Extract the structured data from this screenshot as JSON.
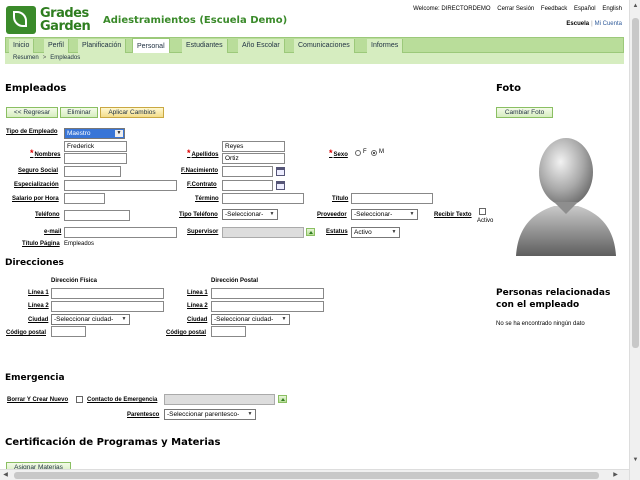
{
  "header": {
    "logo_line1": "Grades",
    "logo_line2": "Garden",
    "app_title": "Adiestramientos (Escuela Demo)",
    "welcome": "Welcome: DIRECTORDEMO",
    "cerrar_sesion": "Cerrar Sesión",
    "feedback": "Feedback",
    "espanol": "Español",
    "english": "English",
    "escuela": "Escuela",
    "mi_cuenta": "Mi Cuenta"
  },
  "nav": {
    "tabs": [
      "Inicio",
      "Perfil",
      "Planificación",
      "Personal",
      "Estudiantes",
      "Año Escolar",
      "Comunicaciones",
      "Informes"
    ],
    "active": "Personal"
  },
  "breadcrumb": [
    "Resumen",
    "Empleados"
  ],
  "empleados": {
    "title": "Empleados",
    "regresar": "<< Regresar",
    "eliminar": "Eliminar",
    "aplicar": "Aplicar Cambios"
  },
  "form": {
    "tipo_empleado_label": "Tipo de Empleado",
    "tipo_empleado_value": "Maestro",
    "nombres_label": "Nombres",
    "nombres_value": "Frederick",
    "apellidos_label": "Apellidos",
    "apellido1_value": "Reyes",
    "apellido2_value": "Ortiz",
    "sexo_label": "Sexo",
    "sexo_f": "F",
    "sexo_m": "M",
    "seguro_social_label": "Seguro Social",
    "f_nacimiento_label": "F.Nacimiento",
    "especializacion_label": "Especialización",
    "f_contrato_label": "F.Contrato",
    "salario_label": "Salario por Hora",
    "termino_label": "Término",
    "titulo_label": "Título",
    "telefono_label": "Teléfono",
    "tipo_telefono_label": "Tipo Teléfono",
    "tipo_telefono_value": "-Seleccionar-",
    "proveedor_label": "Proveedor",
    "proveedor_value": "-Seleccionar-",
    "recibir_texto_label": "Recibir Texto",
    "activo_label": "Activo",
    "email_label": "e-mail",
    "supervisor_label": "Supervisor",
    "estatus_label": "Estatus",
    "estatus_value": "Activo",
    "titulo_pagina_label": "Título Página",
    "titulo_pagina_value": "Empleados"
  },
  "foto": {
    "title": "Foto",
    "cambiar": "Cambiar Foto"
  },
  "direcciones": {
    "title": "Direcciones",
    "fisica": "Dirección Física",
    "postal": "Dirección Postal",
    "linea1": "Línea 1",
    "linea2": "Línea 2",
    "ciudad": "Ciudad",
    "ciudad_value": "-Seleccionar ciudad-",
    "codigo_postal": "Código postal"
  },
  "relacionadas": {
    "title_line1": "Personas relacionadas",
    "title_line2": "con el empleado",
    "empty": "No se ha encontrado ningún dato"
  },
  "emergencia": {
    "title": "Emergencia",
    "borrar_crear": "Borrar Y Crear Nuevo",
    "contacto": "Contacto de Emergencia",
    "parentesco": "Parentesco",
    "parentesco_value": "-Seleccionar parentesco-"
  },
  "certificacion": {
    "title": "Certificación de Programas y Materias",
    "asignar": "Asignar Materias"
  },
  "colors": {
    "brand_green": "#3a8a2a",
    "nav_green": "#b9dd9a",
    "required_red": "#dd0000"
  }
}
